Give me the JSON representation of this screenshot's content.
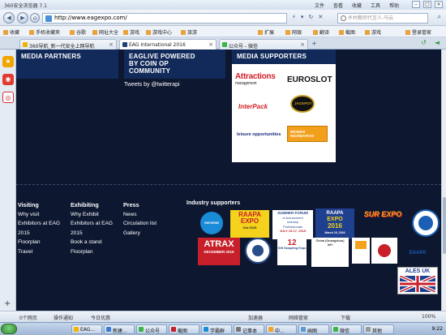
{
  "browser": {
    "title": "360安全浏览器 7.1",
    "menus": [
      "文件",
      "查看",
      "收藏",
      "工具",
      "帮助"
    ],
    "url": "http://www.eagexpo.com/",
    "search_placeholder": "乡村教师代言人-马云"
  },
  "favorites": [
    {
      "label": "收藏"
    },
    {
      "label": "手机收藏夹"
    },
    {
      "label": "谷歌"
    },
    {
      "label": "网址大全"
    },
    {
      "label": "游戏"
    },
    {
      "label": "游戏中心"
    },
    {
      "label": "旅游"
    },
    {
      "label": "扩展"
    },
    {
      "label": "网银"
    },
    {
      "label": "翻译"
    },
    {
      "label": "截图"
    },
    {
      "label": "游戏"
    },
    {
      "label": "登录管家"
    }
  ],
  "tabs": [
    {
      "label": "360导航_新一代安全上网导航"
    },
    {
      "label": "EAG International 2016"
    },
    {
      "label": "公众号 - 微信"
    }
  ],
  "page": {
    "media_partners": "MEDIA PARTNERS",
    "eaglive_line1": "EAGLIVE POWERED",
    "eaglive_line2": "BY COIN OP",
    "eaglive_line3": "COMMUNITY",
    "media_supporters": "MEDIA SUPPORTERS",
    "tweets": "Tweets by @twitterapi",
    "logos": {
      "attractions_1": "Attractions",
      "attractions_2": "management",
      "euroslot": "EUROSLOT",
      "interpack": "InterPack",
      "jackpot": "JACKPOT",
      "leisure": "leisure opportunities",
      "mondo": "MONDO RICREATIVO"
    }
  },
  "footer": {
    "visiting": {
      "heading": "Visiting",
      "links": [
        "Why visit",
        "Exhibitors at EAG",
        "2015",
        "Floorplan",
        "Travel"
      ]
    },
    "exhibiting": {
      "heading": "Exhibiting",
      "links": [
        "Why Exhibit",
        "Exhibitors at EAG",
        "2015",
        "Book a stand",
        "Floorplan"
      ]
    },
    "press": {
      "heading": "Press",
      "links": [
        "News",
        "Circulation list",
        "Gallery"
      ]
    },
    "industry_supporters": "Industry supporters",
    "badges": {
      "euromat": "euromat",
      "raapa_top": "RAAPA",
      "raapa_mid": "EXPO",
      "raapa_bot": "Oct 2015",
      "summer_1": "SUMMER FORUM",
      "summer_2": "of Amusement",
      "summer_3": "Industry",
      "summer_4": "Professionals",
      "summer_5": "JULY 15-17, 2015",
      "raapa16_1": "RAAPA",
      "raapa16_2": "EXPO",
      "raapa16_3": "2016",
      "raapa16_4": "March 15, 2016",
      "surexpo": "SUR EXPO",
      "atrax_1": "ATRAX",
      "atrax_2": "DECEMBER 2015",
      "giant": "12",
      "giant_2": "Gift Sampling Expo",
      "china": "China (Guangzhou) Int'l",
      "eaapa": "EAAPA",
      "ales": "ALES UK"
    }
  },
  "status": {
    "items": [
      "0个网页",
      "操作通知",
      "今日优惠",
      "加速器",
      "网络管家",
      "下载",
      "100%"
    ]
  },
  "taskbar": {
    "items": [
      "EAG...",
      "新建...",
      "公众号",
      "截图",
      "学霸群",
      "记事本",
      "中...",
      "画图",
      "微信",
      "其他"
    ],
    "clock": "9:22"
  },
  "colors": {
    "page_bg": "#0d1730",
    "header_bg": "#112a5a",
    "accent_red": "#c8202a"
  }
}
